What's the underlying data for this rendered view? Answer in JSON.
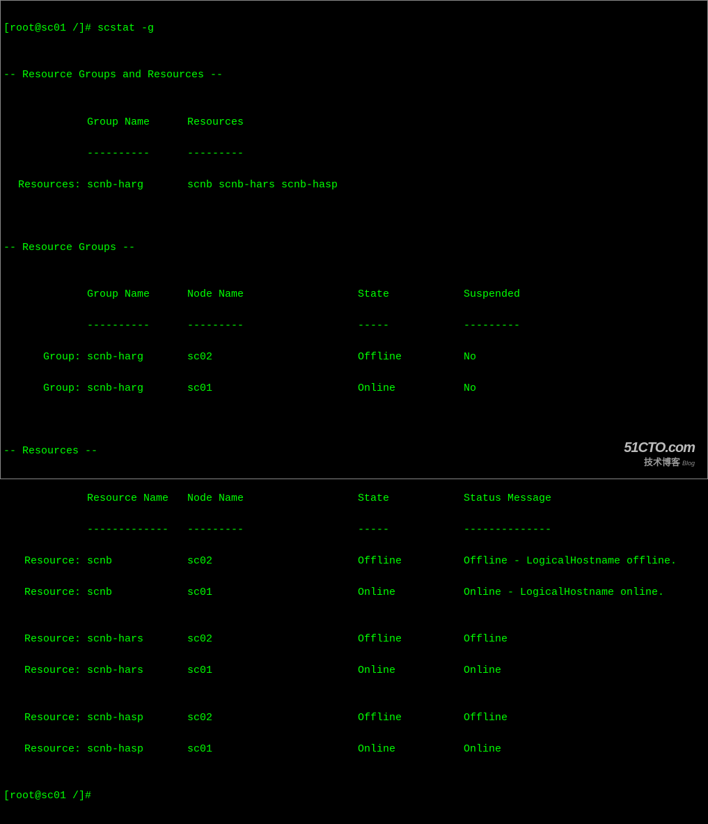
{
  "prompt1": "[root@sc01 /]# ",
  "command": "scstat -g",
  "blank": "",
  "sec1_header": "-- Resource Groups and Resources --",
  "sec1_col1_hdr": "Group Name",
  "sec1_col2_hdr": "Resources",
  "sec1_col1_dash": "----------",
  "sec1_col2_dash": "---------",
  "sec1_row1_label": " Resources: ",
  "sec1_row1_group": "scnb-harg",
  "sec1_row1_resources": "scnb scnb-hars scnb-hasp",
  "sec2_header": "-- Resource Groups --",
  "sec2_col1_hdr": "Group Name",
  "sec2_col2_hdr": "Node Name",
  "sec2_col3_hdr": "State",
  "sec2_col4_hdr": "Suspended",
  "sec2_col1_dash": "----------",
  "sec2_col2_dash": "---------",
  "sec2_col3_dash": "-----",
  "sec2_col4_dash": "---------",
  "sec2_row1_label": "     Group: ",
  "sec2_row1_group": "scnb-harg",
  "sec2_row1_node": "sc02",
  "sec2_row1_state": "Offline",
  "sec2_row1_susp": "No",
  "sec2_row2_label": "     Group: ",
  "sec2_row2_group": "scnb-harg",
  "sec2_row2_node": "sc01",
  "sec2_row2_state": "Online",
  "sec2_row2_susp": "No",
  "sec3_header": "-- Resources --",
  "sec3_col1_hdr": "Resource Name",
  "sec3_col2_hdr": "Node Name",
  "sec3_col3_hdr": "State",
  "sec3_col4_hdr": "Status Message",
  "sec3_col1_dash": "-------------",
  "sec3_col2_dash": "---------",
  "sec3_col3_dash": "-----",
  "sec3_col4_dash": "--------------",
  "sec3_row1_label": "  Resource: ",
  "sec3_row1_name": "scnb",
  "sec3_row1_node": "sc02",
  "sec3_row1_state": "Offline",
  "sec3_row1_msg": "Offline - LogicalHostname offline.",
  "sec3_row2_label": "  Resource: ",
  "sec3_row2_name": "scnb",
  "sec3_row2_node": "sc01",
  "sec3_row2_state": "Online",
  "sec3_row2_msg": "Online - LogicalHostname online.",
  "sec3_row3_label": "  Resource: ",
  "sec3_row3_name": "scnb-hars",
  "sec3_row3_node": "sc02",
  "sec3_row3_state": "Offline",
  "sec3_row3_msg": "Offline",
  "sec3_row4_label": "  Resource: ",
  "sec3_row4_name": "scnb-hars",
  "sec3_row4_node": "sc01",
  "sec3_row4_state": "Online",
  "sec3_row4_msg": "Online",
  "sec3_row5_label": "  Resource: ",
  "sec3_row5_name": "scnb-hasp",
  "sec3_row5_node": "sc02",
  "sec3_row5_state": "Offline",
  "sec3_row5_msg": "Offline",
  "sec3_row6_label": "  Resource: ",
  "sec3_row6_name": "scnb-hasp",
  "sec3_row6_node": "sc01",
  "sec3_row6_state": "Online",
  "sec3_row6_msg": "Online",
  "prompt2": "[root@sc01 /]# ",
  "spacer_label": "            ",
  "watermark_top": "51CTO.com",
  "watermark_bottom": "技术博客",
  "watermark_blog": "Blog"
}
